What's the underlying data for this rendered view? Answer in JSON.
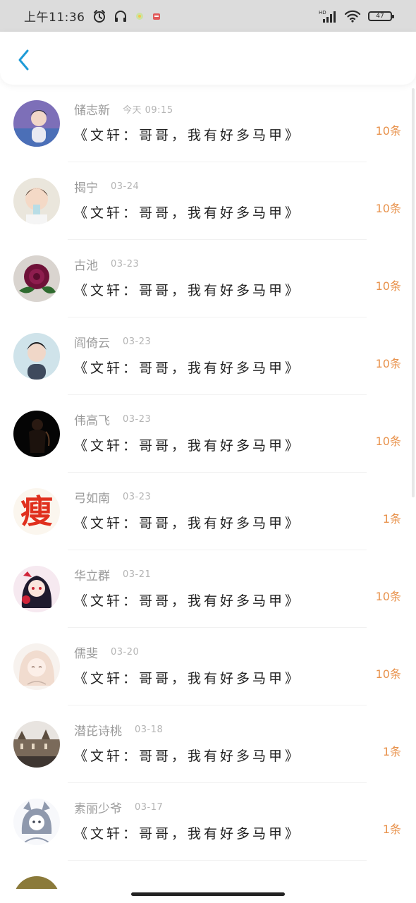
{
  "status_bar": {
    "time": "上午11:36",
    "network_label": "HD",
    "battery_level": "47"
  },
  "header": {
    "back_icon": "chevron-left-icon"
  },
  "colors": {
    "accent": "#1e9bd7",
    "count": "#e8924c",
    "name": "#9b9b9b",
    "title": "#222222"
  },
  "list": {
    "items": [
      {
        "name": "储志新",
        "time": "今天 09:15",
        "title": "《文轩：哥哥，我有好多马甲》",
        "count": "10条"
      },
      {
        "name": "揭宁",
        "time": "03-24",
        "title": "《文轩：哥哥，我有好多马甲》",
        "count": "10条"
      },
      {
        "name": "古池",
        "time": "03-23",
        "title": "《文轩：哥哥，我有好多马甲》",
        "count": "10条"
      },
      {
        "name": "阎倚云",
        "time": "03-23",
        "title": "《文轩：哥哥，我有好多马甲》",
        "count": "10条"
      },
      {
        "name": "伟高飞",
        "time": "03-23",
        "title": "《文轩：哥哥，我有好多马甲》",
        "count": "10条"
      },
      {
        "name": "弓如南",
        "time": "03-23",
        "title": "《文轩：哥哥，我有好多马甲》",
        "count": "1条",
        "avatar_text": "瘦"
      },
      {
        "name": "华立群",
        "time": "03-21",
        "title": "《文轩：哥哥，我有好多马甲》",
        "count": "10条"
      },
      {
        "name": "儒斐",
        "time": "03-20",
        "title": "《文轩：哥哥，我有好多马甲》",
        "count": "10条"
      },
      {
        "name": "潜芘诗桃",
        "time": "03-18",
        "title": "《文轩：哥哥，我有好多马甲》",
        "count": "1条"
      },
      {
        "name": "素丽少爷",
        "time": "03-17",
        "title": "《文轩：哥哥，我有好多马甲》",
        "count": "1条"
      }
    ]
  }
}
